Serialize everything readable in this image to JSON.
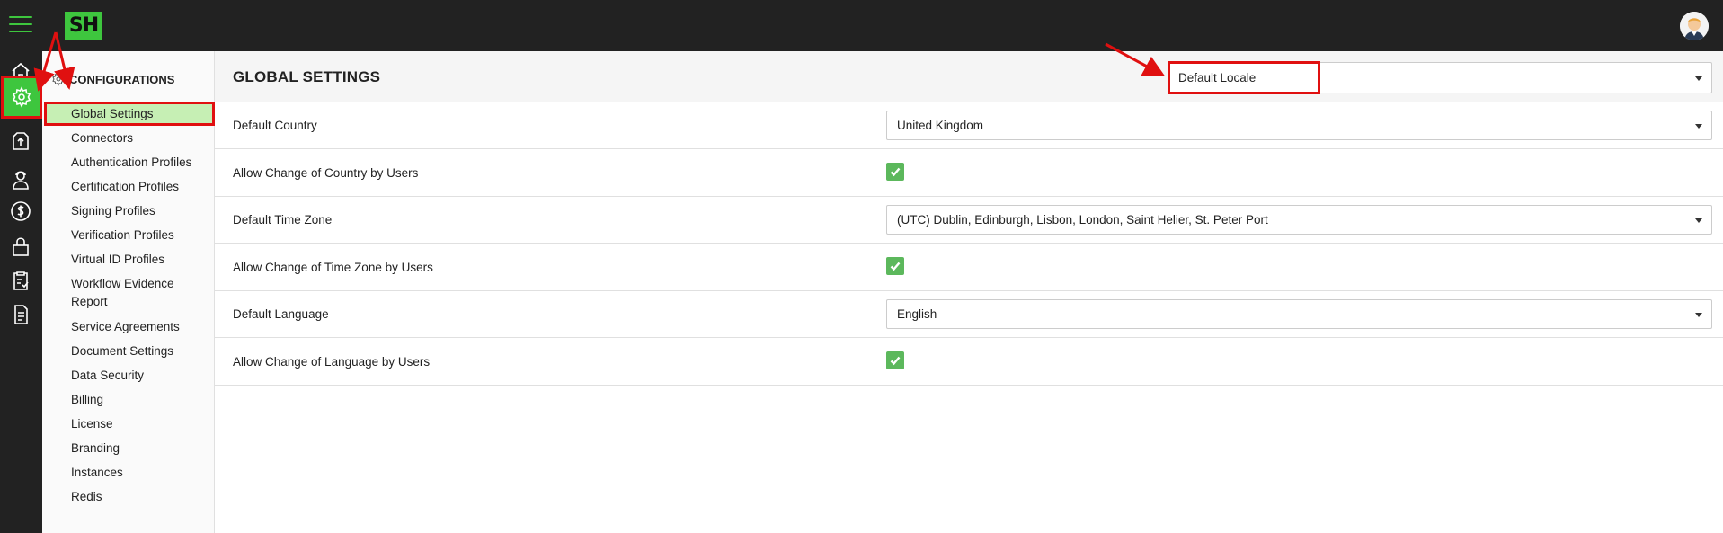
{
  "app": {
    "logo_text": "SH",
    "accent": "#3ec63e",
    "annotation_color": "#e01010"
  },
  "rail": {
    "items": [
      {
        "name": "home-icon"
      },
      {
        "name": "gear-icon",
        "active": true
      },
      {
        "name": "upload-icon"
      },
      {
        "name": "agent-icon"
      },
      {
        "name": "dollar-icon"
      },
      {
        "name": "lock-icon"
      },
      {
        "name": "clipboard-check-icon"
      },
      {
        "name": "document-icon"
      }
    ]
  },
  "sidebar": {
    "heading": "CONFIGURATIONS",
    "items": [
      {
        "label": "Global Settings",
        "active": true
      },
      {
        "label": "Connectors"
      },
      {
        "label": "Authentication Profiles"
      },
      {
        "label": "Certification Profiles"
      },
      {
        "label": "Signing Profiles"
      },
      {
        "label": "Verification Profiles"
      },
      {
        "label": "Virtual ID Profiles"
      },
      {
        "label": "Workflow Evidence Report"
      },
      {
        "label": "Service Agreements"
      },
      {
        "label": "Document Settings"
      },
      {
        "label": "Data Security"
      },
      {
        "label": "Billing"
      },
      {
        "label": "License"
      },
      {
        "label": "Branding"
      },
      {
        "label": "Instances"
      },
      {
        "label": "Redis"
      }
    ]
  },
  "main": {
    "title": "GLOBAL SETTINGS",
    "section_select": "Default Locale",
    "rows": {
      "default_country": {
        "label": "Default Country",
        "value": "United Kingdom"
      },
      "allow_country": {
        "label": "Allow Change of Country by Users",
        "checked": true
      },
      "default_timezone": {
        "label": "Default Time Zone",
        "value": "(UTC) Dublin, Edinburgh, Lisbon, London, Saint Helier, St. Peter Port"
      },
      "allow_timezone": {
        "label": "Allow Change of Time Zone by Users",
        "checked": true
      },
      "default_language": {
        "label": "Default Language",
        "value": "English"
      },
      "allow_language": {
        "label": "Allow Change of Language by Users",
        "checked": true
      }
    }
  }
}
